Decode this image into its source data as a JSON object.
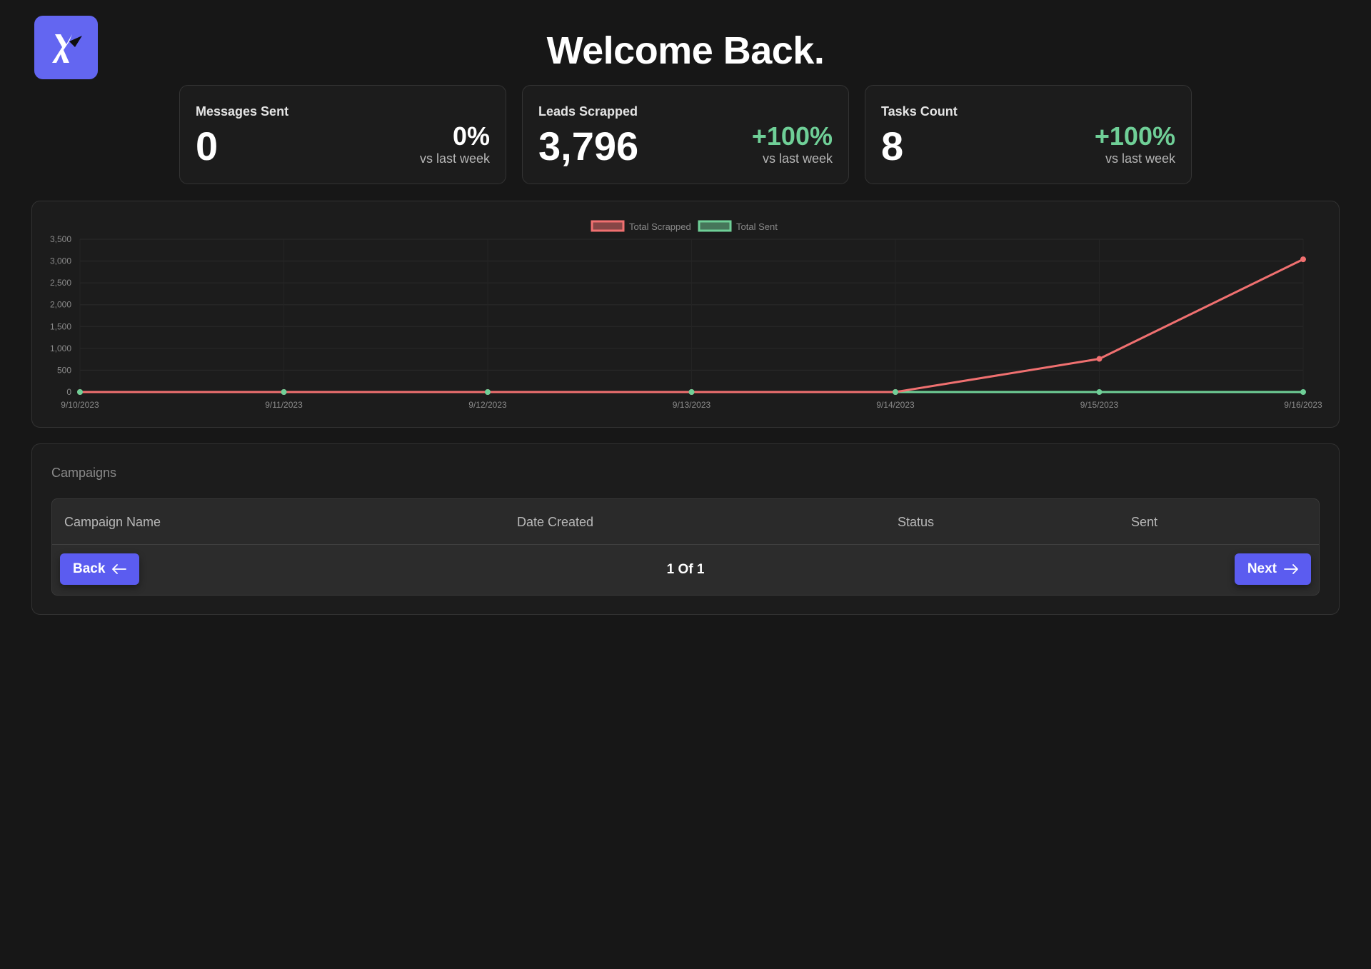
{
  "header": {
    "title": "Welcome Back."
  },
  "stats": [
    {
      "label": "Messages Sent",
      "value": "0",
      "delta": "0%",
      "sub": "vs last week"
    },
    {
      "label": "Leads Scrapped",
      "value": "3,796",
      "delta": "+100%",
      "sub": "vs last week"
    },
    {
      "label": "Tasks Count",
      "value": "8",
      "delta": "+100%",
      "sub": "vs last week"
    }
  ],
  "colors": {
    "accent": "#5b5cf0",
    "positive": "#6fcf97",
    "scrapped": "#f07070",
    "sent": "#6fcf97"
  },
  "chart_data": {
    "type": "line",
    "x": [
      "9/10/2023",
      "9/11/2023",
      "9/12/2023",
      "9/13/2023",
      "9/14/2023",
      "9/15/2023",
      "9/16/2023"
    ],
    "series": [
      {
        "name": "Total Scrapped",
        "values": [
          0,
          0,
          0,
          0,
          0,
          760,
          3040
        ]
      },
      {
        "name": "Total Sent",
        "values": [
          0,
          0,
          0,
          0,
          0,
          0,
          0
        ]
      }
    ],
    "yticks": [
      "0",
      "500",
      "1,000",
      "1,500",
      "2,000",
      "2,500",
      "3,000",
      "3,500"
    ],
    "ylim": [
      0,
      3500
    ],
    "legend": "top-center",
    "grid": true
  },
  "campaigns": {
    "title": "Campaigns",
    "columns": [
      "Campaign Name",
      "Date Created",
      "Status",
      "Sent"
    ],
    "rows": [],
    "back_label": "Back",
    "next_label": "Next",
    "page_label": "1 Of 1"
  }
}
